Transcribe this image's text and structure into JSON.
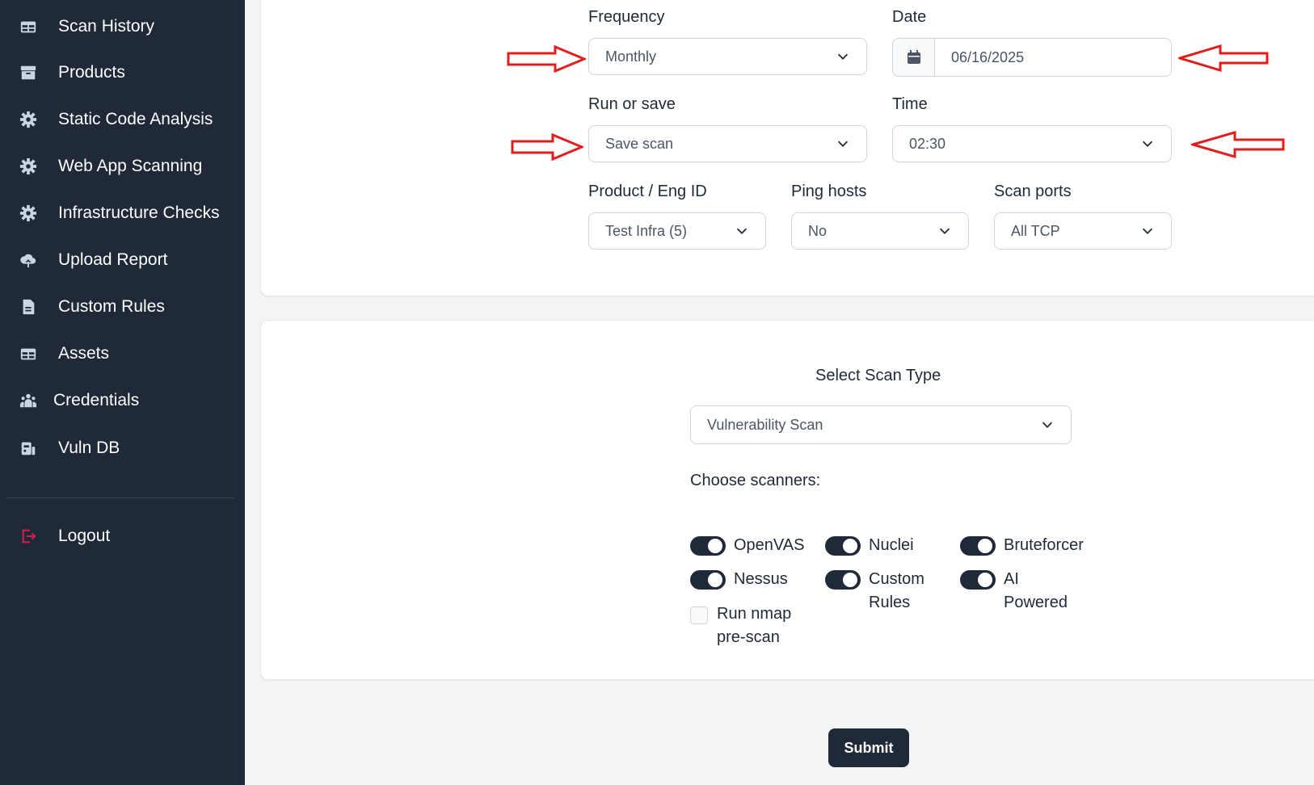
{
  "sidebar": {
    "items": [
      {
        "label": "Scan History",
        "icon": "table-icon"
      },
      {
        "label": "Products",
        "icon": "archive-icon"
      },
      {
        "label": "Static Code Analysis",
        "icon": "gear-icon"
      },
      {
        "label": "Web App Scanning",
        "icon": "gear-icon"
      },
      {
        "label": "Infrastructure Checks",
        "icon": "gear-icon"
      },
      {
        "label": "Upload Report",
        "icon": "cloud-upload-icon"
      },
      {
        "label": "Custom Rules",
        "icon": "document-icon"
      },
      {
        "label": "Assets",
        "icon": "table-icon"
      },
      {
        "label": "Credentials",
        "icon": "users-icon"
      },
      {
        "label": "Vuln DB",
        "icon": "database-icon"
      }
    ],
    "logout": "Logout",
    "logout_color": "#e11d48"
  },
  "schedule": {
    "frequency_label": "Frequency",
    "frequency_value": "Monthly",
    "date_label": "Date",
    "date_value": "06/16/2025",
    "run_label": "Run or save",
    "run_value": "Save scan",
    "time_label": "Time",
    "time_value": "02:30",
    "product_label": "Product / Eng ID",
    "product_value": "Test Infra (5)",
    "ping_label": "Ping hosts",
    "ping_value": "No",
    "ports_label": "Scan ports",
    "ports_value": "All TCP"
  },
  "scan": {
    "type_label": "Select Scan Type",
    "type_value": "Vulnerability Scan",
    "scanners_label": "Choose scanners:",
    "scanners": [
      {
        "label": "OpenVAS",
        "on": true
      },
      {
        "label": "Nuclei",
        "on": true
      },
      {
        "label": "Bruteforcer",
        "on": true
      },
      {
        "label": "Nessus",
        "on": true
      },
      {
        "label": "Custom Rules",
        "on": true
      },
      {
        "label": "AI Powered",
        "on": true
      }
    ],
    "nmap_label": "Run nmap pre-scan",
    "nmap_checked": false
  },
  "submit_label": "Submit",
  "colors": {
    "sidebar_bg": "#1f2937",
    "annotation_arrow": "#e11d1d",
    "toggle_on": "#1f2937"
  }
}
